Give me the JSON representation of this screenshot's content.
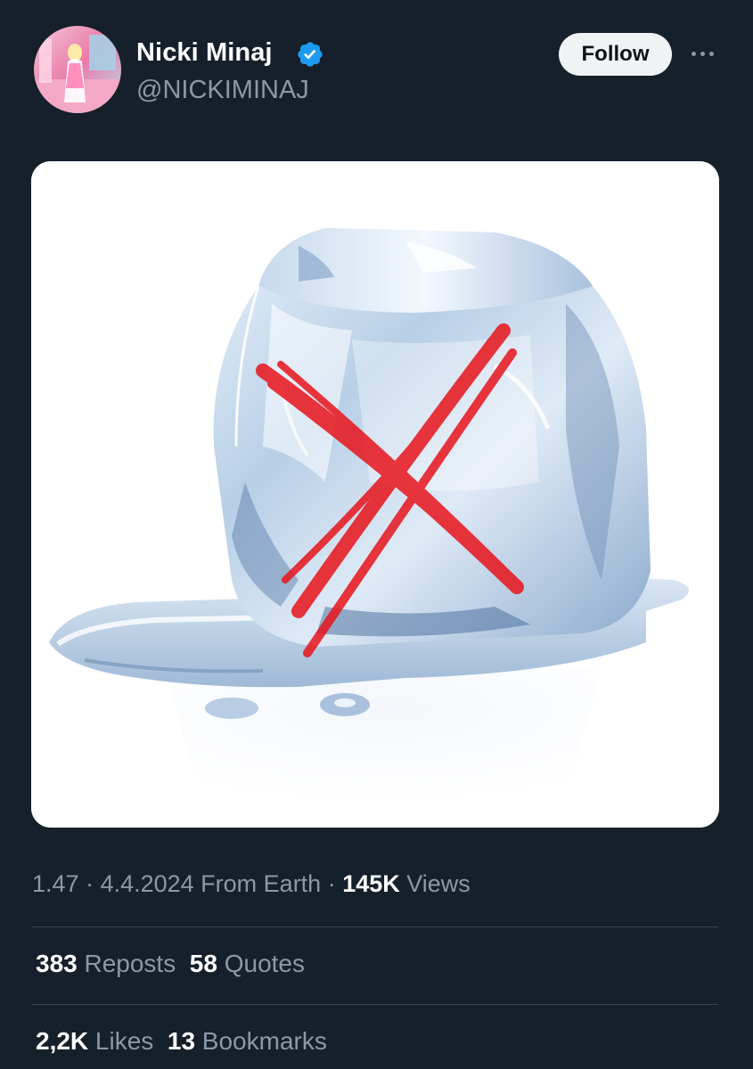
{
  "tweet": {
    "author": {
      "display_name": "Nicki Minaj",
      "handle": "@NICKIMINAJ",
      "verified": true
    },
    "follow_label": "Follow",
    "meta": {
      "time": "1.47",
      "sep1": " · ",
      "date": "4.4.2024",
      "location": " From Earth",
      "sep2": " · ",
      "views_count": "145K",
      "views_label": " Views"
    },
    "stats_row1": {
      "reposts_count": "383",
      "reposts_label": " Reposts",
      "quotes_count": "58",
      "quotes_label": " Quotes"
    },
    "stats_row2": {
      "likes_count": "2,2K",
      "likes_label": " Likes",
      "bookmarks_count": "13",
      "bookmarks_label": " Bookmarks"
    },
    "media": {
      "description_icon": "ice-cube-with-red-x"
    }
  },
  "colors": {
    "background": "#15202b",
    "text_primary": "#ffffff",
    "text_secondary": "#8b98a5",
    "verified_blue": "#1d9bf0",
    "divider": "#38444d",
    "follow_bg": "#eff3f4",
    "red_x": "#e8141c"
  }
}
